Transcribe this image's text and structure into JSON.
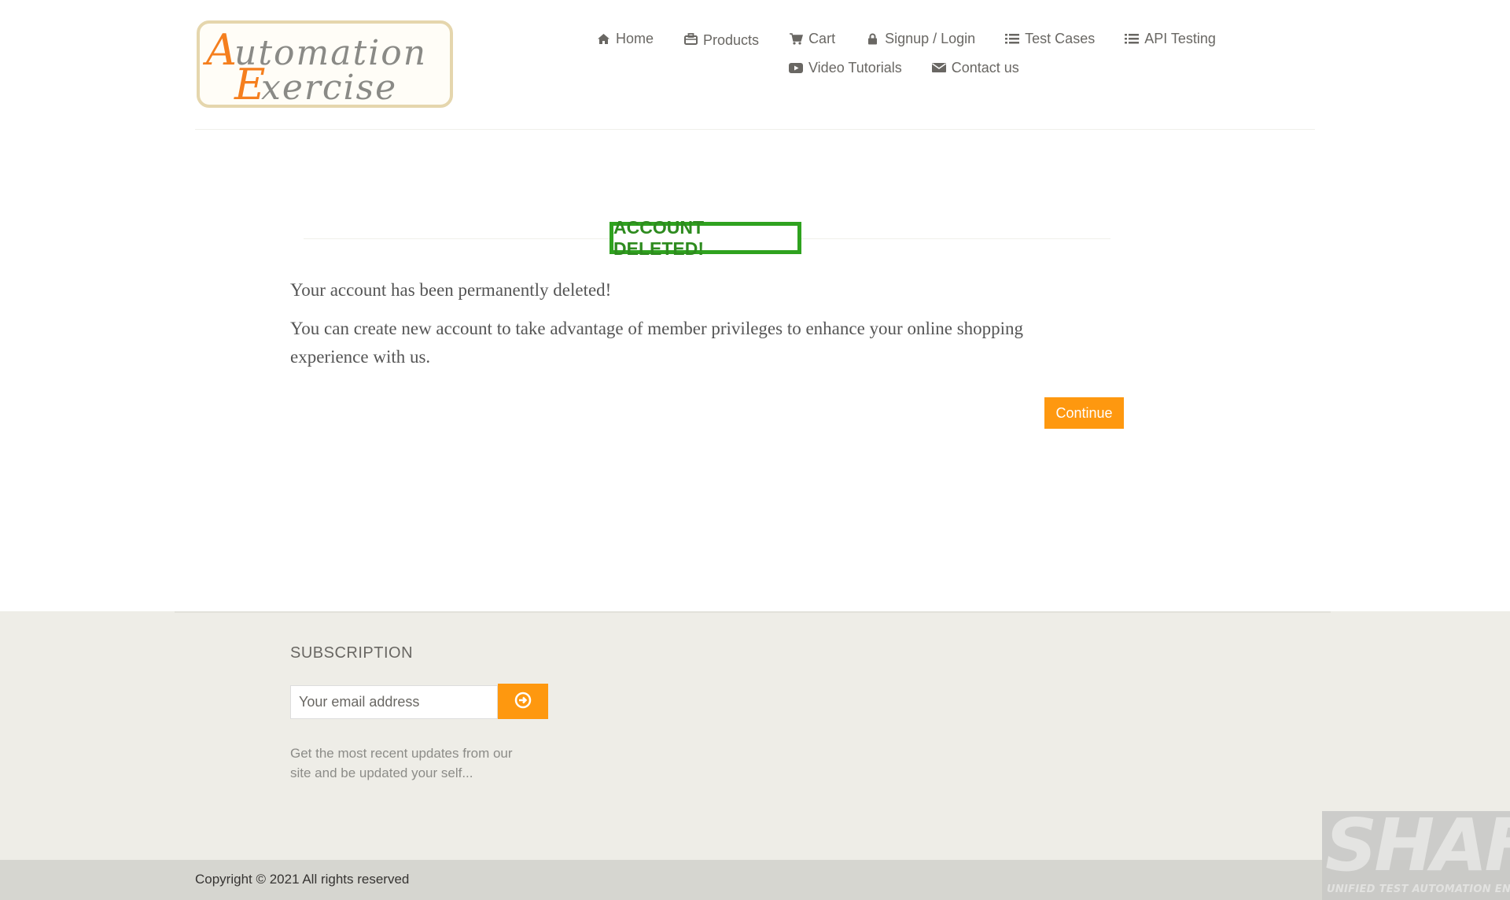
{
  "logo": {
    "line1_initial": "A",
    "line1_rest": "utomation",
    "line2_initial": "E",
    "line2_rest": "xercise"
  },
  "nav": {
    "row1": [
      {
        "label": "Home",
        "icon": "home-icon"
      },
      {
        "label": "Products",
        "icon": "briefcase-icon"
      },
      {
        "label": "Cart",
        "icon": "cart-icon"
      },
      {
        "label": "Signup / Login",
        "icon": "lock-icon"
      },
      {
        "label": "Test Cases",
        "icon": "list-icon"
      },
      {
        "label": "API Testing",
        "icon": "list-icon"
      }
    ],
    "row2": [
      {
        "label": "Video Tutorials",
        "icon": "youtube-play-icon"
      },
      {
        "label": "Contact us",
        "icon": "envelope-icon"
      }
    ]
  },
  "main": {
    "title": "ACCOUNT DELETED!",
    "message1": "Your account has been permanently deleted!",
    "message2": "You can create new account to take advantage of member privileges to enhance your online shopping experience with us.",
    "continue_label": "Continue"
  },
  "footer": {
    "subscription_title": "SUBSCRIPTION",
    "email_placeholder": "Your email address",
    "subscribe_icon": "arrow-circle-right-icon",
    "description": "Get the most recent updates from our site and be updated your self...",
    "copyright": "Copyright © 2021 All rights reserved"
  },
  "watermark": {
    "title": "SHAFT",
    "subtitle": "UNIFIED TEST AUTOMATION ENGINE"
  },
  "colors": {
    "accent": "#fe980f",
    "success_green": "#2fa21f",
    "footer_bg": "#eeede7",
    "footer_bottom_bg": "#d6d6d0",
    "text": "#696763"
  }
}
